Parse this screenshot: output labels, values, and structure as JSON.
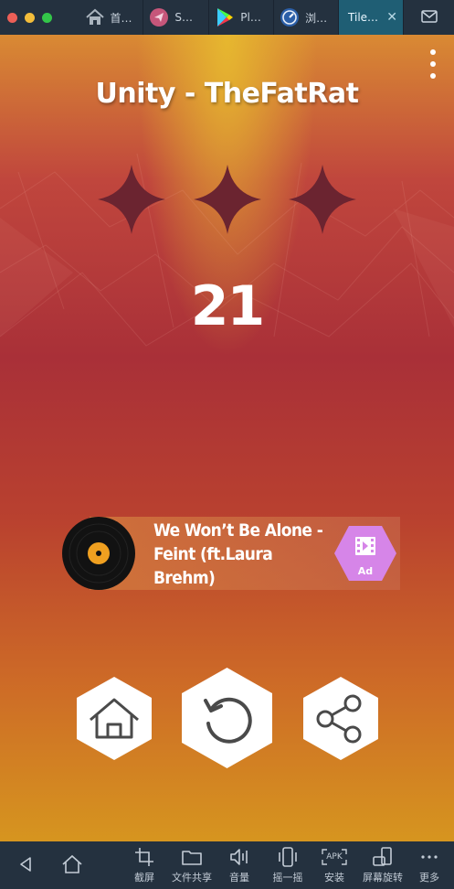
{
  "window": {
    "traffic_colors": [
      "#ec5f57",
      "#f3bd3b",
      "#33c649"
    ],
    "tabs": [
      {
        "label": "首…",
        "icon": "home-icon",
        "active": false
      },
      {
        "label": "S…",
        "icon": "paper-plane-icon",
        "active": false
      },
      {
        "label": "Pl…",
        "icon": "play-store-icon",
        "active": false
      },
      {
        "label": "浏…",
        "icon": "browser-icon",
        "active": false
      },
      {
        "label": "Tile…",
        "icon": "",
        "active": true
      }
    ],
    "close_glyph": "✕",
    "mail_icon": "mail-icon"
  },
  "game": {
    "song_title": "Unity - TheFatRat",
    "stars_earned": 0,
    "stars_total": 3,
    "score": "21",
    "next_song": {
      "lines": [
        "We Won’t Be Alone -",
        "Feint (ft.Laura",
        "Brehm)"
      ],
      "ad_label": "Ad"
    },
    "buttons": [
      {
        "name": "home-button",
        "icon": "home-icon"
      },
      {
        "name": "retry-button",
        "icon": "retry-icon"
      },
      {
        "name": "share-button",
        "icon": "share-icon"
      }
    ],
    "colors": {
      "star_dark": "#6b2430",
      "ad_hex": "#d685e8",
      "button_fill": "#ffffff",
      "icon_gray": "#4a4a4a"
    }
  },
  "toolbar": {
    "items": [
      {
        "label": "",
        "icon": "back-icon"
      },
      {
        "label": "",
        "icon": "home-icon"
      },
      {
        "label": "截屏",
        "icon": "crop-icon"
      },
      {
        "label": "文件共享",
        "icon": "folder-icon"
      },
      {
        "label": "音量",
        "icon": "volume-icon"
      },
      {
        "label": "摇一摇",
        "icon": "shake-icon"
      },
      {
        "label": "安装",
        "icon": "apk-icon"
      },
      {
        "label": "屏幕旋转",
        "icon": "rotate-screen-icon"
      },
      {
        "label": "更多",
        "icon": "more-icon"
      }
    ],
    "apk_text": "APK"
  }
}
